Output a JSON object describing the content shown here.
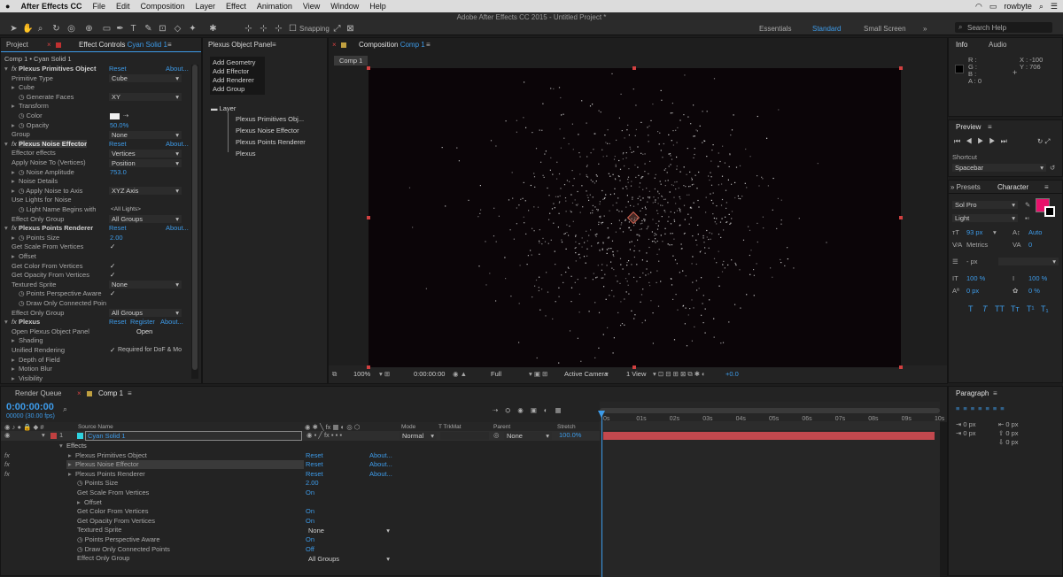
{
  "menubar": {
    "app": "After Effects CC",
    "items": [
      "File",
      "Edit",
      "Composition",
      "Layer",
      "Effect",
      "Animation",
      "View",
      "Window",
      "Help"
    ],
    "user": "rowbyte",
    "window_title": "Adobe After Effects CC 2015 - Untitled Project *"
  },
  "toolbar": {
    "snapping": "Snapping",
    "workspaces": [
      "Essentials",
      "Standard",
      "Small Screen"
    ],
    "search": "Search Help"
  },
  "project_tab": "Project",
  "effect_controls": {
    "tab_label": "Effect Controls",
    "tab_target": "Cyan Solid 1",
    "path": "Comp 1 • Cyan Solid 1",
    "rows": [
      {
        "indent": 0,
        "fx": true,
        "label": "Plexus Primitives Object",
        "reset": "Reset",
        "about": "About..."
      },
      {
        "indent": 1,
        "label": "Primitive Type",
        "select": "Cube"
      },
      {
        "indent": 1,
        "tri": true,
        "label": "Cube"
      },
      {
        "indent": 2,
        "stopwatch": true,
        "label": "Generate Faces",
        "select": "XY"
      },
      {
        "indent": 1,
        "tri": true,
        "label": "Transform"
      },
      {
        "indent": 2,
        "stopwatch": true,
        "label": "Color",
        "swatch": true
      },
      {
        "indent": 1,
        "tri": true,
        "stopwatch": true,
        "label": "Opacity",
        "value": "50.0%"
      },
      {
        "indent": 1,
        "label": "Group",
        "select": "None"
      },
      {
        "indent": 0,
        "fx": true,
        "label": "Plexus Noise Effector",
        "reset": "Reset",
        "about": "About...",
        "highlight": true
      },
      {
        "indent": 1,
        "label": "Effector effects",
        "select": "Vertices"
      },
      {
        "indent": 1,
        "label": "Apply Noise To (Vertices)",
        "select": "Position"
      },
      {
        "indent": 1,
        "tri": true,
        "stopwatch": true,
        "label": "Noise Amplitude",
        "value": "753.0"
      },
      {
        "indent": 1,
        "tri": true,
        "label": "Noise Details"
      },
      {
        "indent": 1,
        "tri": true,
        "stopwatch": true,
        "label": "Apply Noise to Axis",
        "select": "XYZ Axis"
      },
      {
        "indent": 1,
        "label": "Use Lights for Noise"
      },
      {
        "indent": 2,
        "stopwatch": true,
        "label": "Light Name Begins with",
        "text": "<All Lights>"
      },
      {
        "indent": 1,
        "label": "Effect Only Group",
        "select": "All Groups"
      },
      {
        "indent": 0,
        "fx": true,
        "label": "Plexus Points Renderer",
        "reset": "Reset",
        "about": "About..."
      },
      {
        "indent": 1,
        "tri": true,
        "stopwatch": true,
        "label": "Points Size",
        "value": "2.00"
      },
      {
        "indent": 1,
        "label": "Get Scale From Vertices",
        "check": "✓"
      },
      {
        "indent": 1,
        "tri": true,
        "label": "Offset"
      },
      {
        "indent": 1,
        "label": "Get Color From Vertices",
        "check": "✓"
      },
      {
        "indent": 1,
        "label": "Get Opacity From Vertices",
        "check": "✓"
      },
      {
        "indent": 1,
        "label": "Textured Sprite",
        "select": "None"
      },
      {
        "indent": 2,
        "stopwatch": true,
        "label": "Points Perspective Aware",
        "check": "✓"
      },
      {
        "indent": 2,
        "stopwatch": true,
        "label": "Draw Only Connected Poin"
      },
      {
        "indent": 1,
        "label": "Effect Only Group",
        "select": "All Groups"
      },
      {
        "indent": 0,
        "fx": true,
        "label": "Plexus",
        "reset": "Reset",
        "register": "Register",
        "about": "About..."
      },
      {
        "indent": 1,
        "label": "Open Plexus Object Panel",
        "button": "Open"
      },
      {
        "indent": 1,
        "tri": true,
        "label": "Shading"
      },
      {
        "indent": 1,
        "label": "Unified Rendering",
        "check": "✓",
        "text": "Required for DoF & Mo"
      },
      {
        "indent": 1,
        "tri": true,
        "label": "Depth of Field"
      },
      {
        "indent": 1,
        "tri": true,
        "label": "Motion Blur"
      },
      {
        "indent": 1,
        "tri": true,
        "label": "Visibility"
      }
    ]
  },
  "plexus_panel": {
    "title": "Plexus Object Panel",
    "add_buttons": [
      "Add Geometry",
      "Add Effector",
      "Add Renderer",
      "Add Group"
    ],
    "layer_label": "Layer",
    "tree": [
      "Plexus Primitives Obj...",
      "Plexus Noise Effector",
      "Plexus Points Renderer",
      "Plexus"
    ]
  },
  "composition": {
    "tab_label": "Composition",
    "tab_target": "Comp 1",
    "sub_tab": "Comp 1",
    "footer": {
      "zoom": "100%",
      "timecode": "0:00:00:00",
      "resolution": "Full",
      "camera": "Active Camera",
      "views": "1 View",
      "exposure": "+0.0"
    }
  },
  "info": {
    "tabs": [
      "Info",
      "Audio"
    ],
    "r": "R :",
    "g": "G :",
    "b": "B :",
    "a": "A : 0",
    "x": "X : -100",
    "y": "Y : 706"
  },
  "preview": {
    "title": "Preview",
    "shortcut_label": "Shortcut",
    "shortcut": "Spacebar"
  },
  "character": {
    "tabs": [
      "Presets",
      "Character"
    ],
    "font": "Sol Pro",
    "style": "Light",
    "size": "93 px",
    "leading": "Auto",
    "kerning": "Metrics",
    "tracking": "0",
    "stroke": "- px",
    "v_scale": "100 %",
    "h_scale": "100 %",
    "baseline": "0 px",
    "tsume": "0 %",
    "fill_color": "#e8116b",
    "styles": [
      "T",
      "T",
      "TT",
      "Tᴛ",
      "T¹",
      "T₁"
    ]
  },
  "paragraph": {
    "title": "Paragraph",
    "indents": [
      "0 px",
      "0 px",
      "0 px",
      "0 px",
      "0 px"
    ]
  },
  "timeline": {
    "tabs": [
      "Render Queue",
      "Comp 1"
    ],
    "timecode": "0:00:00:00",
    "fps": "00000 (30.00 fps)",
    "columns": [
      "Source Name",
      "Mode",
      "TrkMat",
      "Parent",
      "Stretch"
    ],
    "ruler": [
      "0s",
      "01s",
      "02s",
      "03s",
      "04s",
      "05s",
      "06s",
      "07s",
      "08s",
      "09s",
      "10s"
    ],
    "layer": {
      "num": "1",
      "name": "Cyan Solid 1",
      "mode": "Normal",
      "parent": "None",
      "stretch": "100.0%"
    },
    "rows": [
      {
        "indent": 0,
        "label": "Effects",
        "fx": false
      },
      {
        "indent": 1,
        "label": "Plexus Primitives Object",
        "fx": true,
        "reset": "Reset",
        "about": "About..."
      },
      {
        "indent": 1,
        "label": "Plexus Noise Effector",
        "fx": true,
        "reset": "Reset",
        "about": "About...",
        "highlight": true
      },
      {
        "indent": 1,
        "label": "Plexus Points Renderer",
        "fx": true,
        "reset": "Reset",
        "about": "About..."
      },
      {
        "indent": 2,
        "label": "Points Size",
        "stopwatch": true,
        "value": "2.00"
      },
      {
        "indent": 2,
        "label": "Get Scale From Vertices",
        "value": "On"
      },
      {
        "indent": 2,
        "label": "Offset",
        "tri": true
      },
      {
        "indent": 2,
        "label": "Get Color From Vertices",
        "value": "On"
      },
      {
        "indent": 2,
        "label": "Get Opacity From Vertices",
        "value": "On"
      },
      {
        "indent": 2,
        "label": "Textured Sprite",
        "select": "None"
      },
      {
        "indent": 2,
        "label": "Points Perspective Aware",
        "stopwatch": true,
        "value": "On"
      },
      {
        "indent": 2,
        "label": "Draw Only Connected Points",
        "stopwatch": true,
        "value": "Off"
      },
      {
        "indent": 2,
        "label": "Effect Only Group",
        "select": "All Groups"
      }
    ]
  }
}
